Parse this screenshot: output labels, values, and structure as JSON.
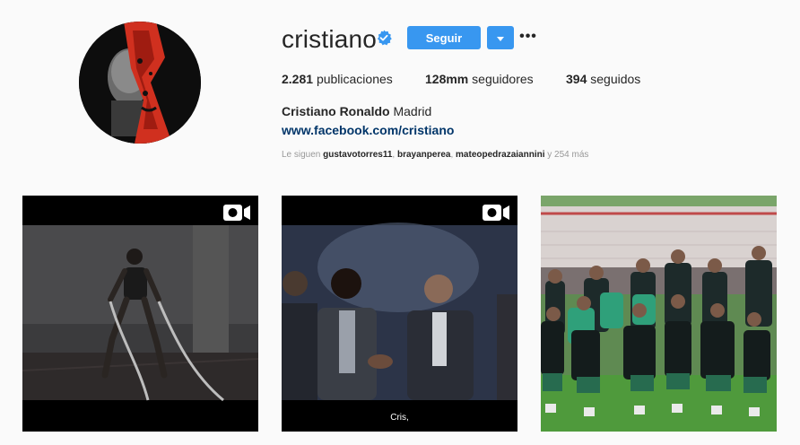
{
  "profile": {
    "username": "cristiano",
    "follow_label": "Seguir",
    "more_label": "•••",
    "verified_icon": "verified-badge-icon",
    "stats": {
      "posts_value": "2.281",
      "posts_label": "publicaciones",
      "followers_value": "128mm",
      "followers_label": "seguidores",
      "following_value": "394",
      "following_label": "seguidos"
    },
    "bio": {
      "full_name": "Cristiano Ronaldo",
      "extra": "Madrid",
      "link": "www.facebook.com/cristiano"
    },
    "followed_by": {
      "prefix": "Le siguen",
      "users": [
        "gustavotorres11",
        "brayanperea",
        "mateopedrazaiannini"
      ],
      "suffix": "y 254 más"
    }
  },
  "posts": [
    {
      "type": "video",
      "icon": "video-icon",
      "caption": ""
    },
    {
      "type": "video",
      "icon": "video-icon",
      "caption": "Cris,"
    },
    {
      "type": "photo",
      "icon": "",
      "caption": ""
    }
  ],
  "colors": {
    "accent": "#3897f0",
    "link": "#003569",
    "text": "#262626",
    "muted": "#999999",
    "background": "#fafafa"
  }
}
